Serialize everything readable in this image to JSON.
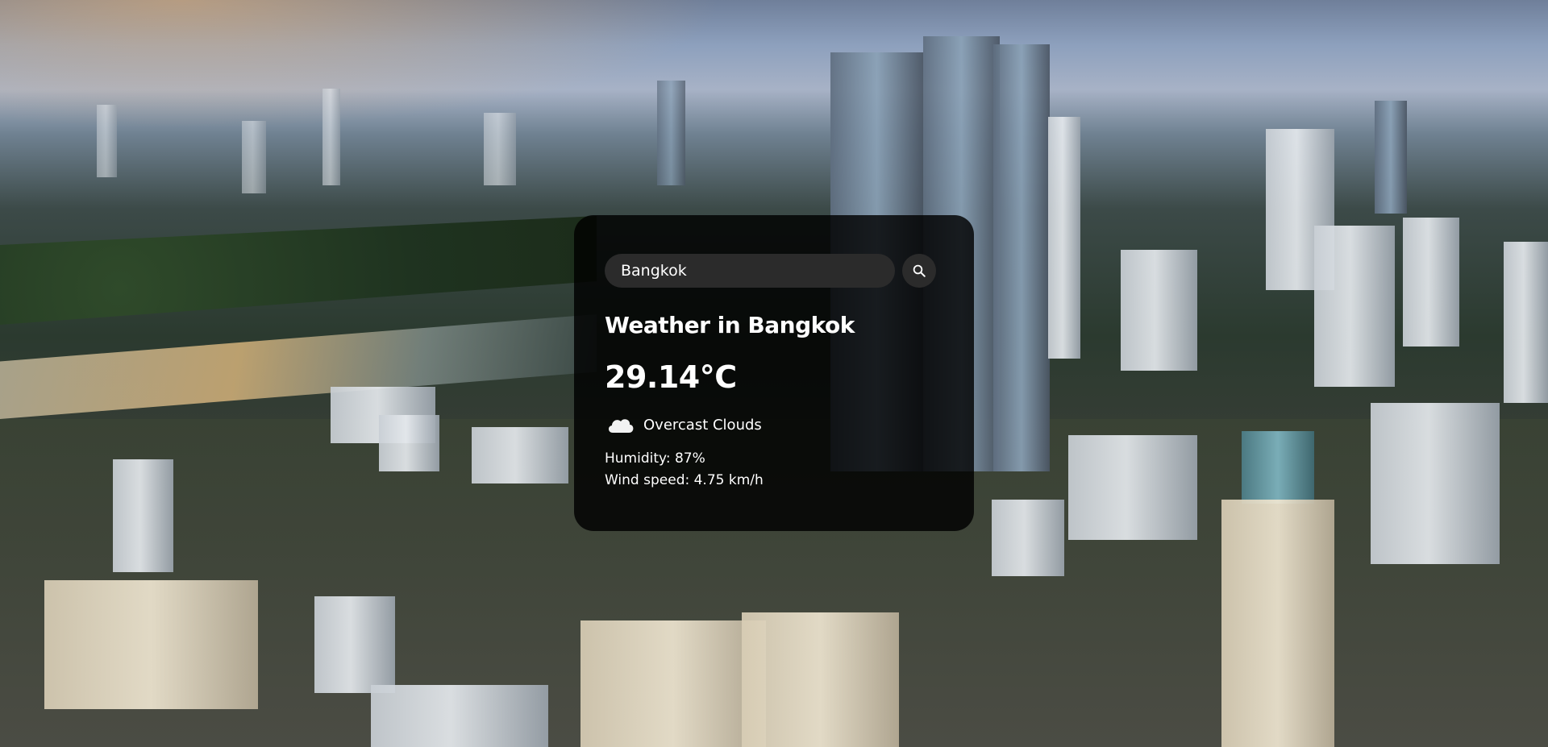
{
  "search": {
    "value": "Bangkok",
    "placeholder": "Search"
  },
  "weather": {
    "title": "Weather in Bangkok",
    "temperature": "29.14°C",
    "description": "Overcast Clouds",
    "icon": "cloud-icon",
    "humidity": "Humidity: 87%",
    "wind": "Wind speed: 4.75 km/h"
  },
  "colors": {
    "card_background": "#000000",
    "input_background": "#2b2b2b",
    "text": "#ffffff"
  }
}
